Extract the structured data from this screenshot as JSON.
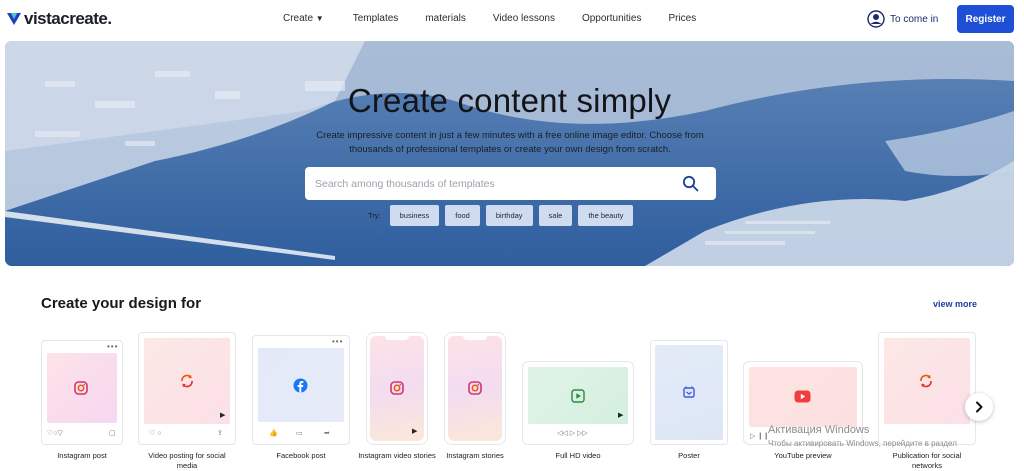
{
  "header": {
    "logo_text": "vistacreate.",
    "nav": [
      "Create",
      "Templates",
      "materials",
      "Video lessons",
      "Opportunities",
      "Prices"
    ],
    "signin_label": "To come in",
    "register_label": "Register"
  },
  "hero": {
    "title": "Create content simply",
    "description": "Create impressive content in just a few minutes with a free online image editor. Choose from thousands of professional templates or create your own design from scratch.",
    "search_placeholder": "Search among thousands of templates",
    "try_label": "Try:",
    "chips": [
      "business",
      "food",
      "birthday",
      "sale",
      "the beauty"
    ]
  },
  "section": {
    "title": "Create your design for",
    "view_more": "view more"
  },
  "cards": [
    {
      "label": "Instagram post",
      "icon": "instagram-icon"
    },
    {
      "label": "Video posting for social media",
      "icon": "refresh-icon"
    },
    {
      "label": "Facebook post",
      "icon": "facebook-icon"
    },
    {
      "label": "Instagram video stories",
      "icon": "instagram-icon"
    },
    {
      "label": "Instagram stories",
      "icon": "instagram-icon"
    },
    {
      "label": "Full HD video",
      "icon": "play-icon"
    },
    {
      "label": "Poster",
      "icon": "poster-icon"
    },
    {
      "label": "YouTube preview",
      "icon": "youtube-icon"
    },
    {
      "label": "Publication for social networks",
      "icon": "refresh-icon"
    }
  ],
  "watermark": {
    "line1": "Активация Windows",
    "line2": "Чтобы активировать Windows, перейдите в раздел"
  }
}
